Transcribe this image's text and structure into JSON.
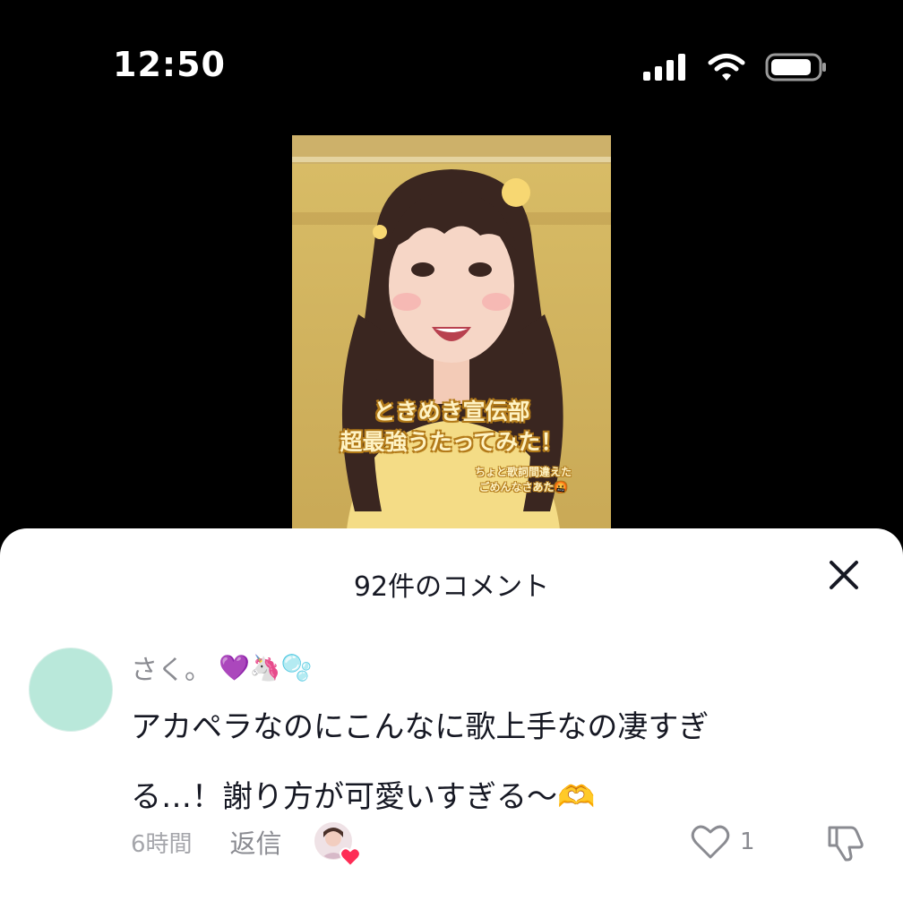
{
  "status_bar": {
    "time": "12:50"
  },
  "video": {
    "caption_main_line1": "ときめき宣伝部",
    "caption_main_line2": "超最強うたってみた！",
    "caption_sub_line1": "ちょと歌詞間違えた",
    "caption_sub_line2": "ごめんなさあた🤬"
  },
  "comments_sheet": {
    "title": "92件のコメント",
    "comment": {
      "username": "さく。",
      "username_emojis": "💜🦄🫧",
      "text_line1": "アカペラなのにこんなに歌上手なの凄すぎ",
      "text_line2": "る…！謝り方が可愛いすぎる〜🫶",
      "time": "6時間",
      "reply_label": "返信",
      "like_count": "1"
    }
  },
  "icons": {
    "close": "close-icon",
    "heart": "heart-outline-icon",
    "dislike": "thumbs-down-icon",
    "creator_heart": "heart-filled-icon"
  },
  "colors": {
    "accent_heart": "#fe2c55",
    "avatar_bg": "#b9e8da"
  }
}
